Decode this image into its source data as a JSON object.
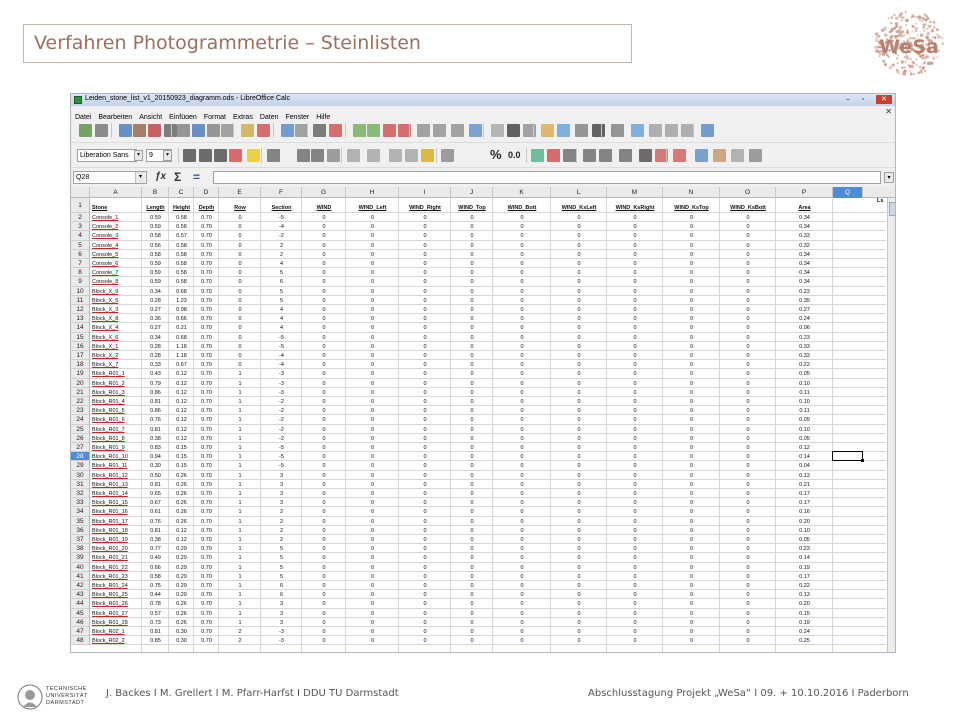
{
  "slide": {
    "title": "Verfahren Photogrammetrie – Steinlisten",
    "logo_text": "WeSa",
    "footer_university": [
      "TECHNISCHE",
      "UNIVERSITÄT",
      "DARMSTADT"
    ],
    "footer_left": "J. Backes I M. Grellert I M. Pfarr-Harfst I DDU TU Darmstadt",
    "footer_right": "Abschlusstagung Projekt „WeSa“ I 09. + 10.10.2016 I Paderborn",
    "colors": {
      "title": "#9c6f5f",
      "title_border": "#cbb5a9",
      "logo": "#b5806c"
    }
  },
  "window": {
    "title": "Leiden_stone_list_v1_20150923_diagramm.ods - LibreOffice Calc",
    "controls": [
      "minimize",
      "maximize",
      "close"
    ]
  },
  "menu": [
    "Datei",
    "Bearbeiten",
    "Ansicht",
    "Einfügen",
    "Format",
    "Extras",
    "Daten",
    "Fenster",
    "Hilfe"
  ],
  "format_toolbar": {
    "font_name": "Liberation Sans",
    "font_size": "9",
    "percent_glyph": "%",
    "number_glyph": "0.0"
  },
  "formula_bar": {
    "cell_ref": "Q28",
    "sum_glyph": "Σ",
    "equals_glyph": "=",
    "value": ""
  },
  "grid": {
    "columns": [
      "A",
      "B",
      "C",
      "D",
      "E",
      "F",
      "G",
      "H",
      "I",
      "J",
      "K",
      "L",
      "M",
      "N",
      "O",
      "P",
      "Q"
    ],
    "active_column": "Q",
    "active_row": 28,
    "header_row": [
      "",
      "Stone",
      "Length",
      "Height",
      "Depth",
      "Row",
      "Section",
      "WIND",
      "WIND_Left",
      "WIND_Right",
      "WIND_Top",
      "WIND_Bott",
      "WIND_KsLeft",
      "WIND_KsRight",
      "WIND_KsTop",
      "WIND_KsBott",
      "Area",
      ""
    ],
    "overflow_header": "Ls",
    "rows": [
      [
        "Console_1",
        "0.59",
        "0.58",
        "0.70",
        "0",
        "-5",
        "0",
        "0",
        "0",
        "0",
        "0",
        "0",
        "0",
        "0",
        "0",
        "0.34"
      ],
      [
        "Console_2",
        "0.59",
        "0.58",
        "0.70",
        "0",
        "-4",
        "0",
        "0",
        "0",
        "0",
        "0",
        "0",
        "0",
        "0",
        "0",
        "0.34"
      ],
      [
        "Console_3",
        "0.58",
        "0.57",
        "0.70",
        "0",
        "-2",
        "0",
        "0",
        "0",
        "0",
        "0",
        "0",
        "0",
        "0",
        "0",
        "0.33"
      ],
      [
        "Console_4",
        "0.56",
        "0.58",
        "0.70",
        "0",
        "2",
        "0",
        "0",
        "0",
        "0",
        "0",
        "0",
        "0",
        "0",
        "0",
        "0.32"
      ],
      [
        "Console_5",
        "0.58",
        "0.58",
        "0.70",
        "0",
        "2",
        "0",
        "0",
        "0",
        "0",
        "0",
        "0",
        "0",
        "0",
        "0",
        "0.34"
      ],
      [
        "Console_6",
        "0.59",
        "0.58",
        "0.70",
        "0",
        "4",
        "0",
        "0",
        "0",
        "0",
        "0",
        "0",
        "0",
        "0",
        "0",
        "0.34"
      ],
      [
        "Console_7",
        "0.59",
        "0.58",
        "0.70",
        "0",
        "5",
        "0",
        "0",
        "0",
        "0",
        "0",
        "0",
        "0",
        "0",
        "0",
        "0.34"
      ],
      [
        "Console_8",
        "0.59",
        "0.58",
        "0.70",
        "0",
        "6",
        "0",
        "0",
        "0",
        "0",
        "0",
        "0",
        "0",
        "0",
        "0",
        "0.34"
      ],
      [
        "Block_X_9",
        "0.34",
        "0.68",
        "0.70",
        "0",
        "5",
        "0",
        "0",
        "0",
        "0",
        "0",
        "0",
        "0",
        "0",
        "0",
        "0.23"
      ],
      [
        "Block_X_5",
        "0.28",
        "1.23",
        "0.70",
        "0",
        "5",
        "0",
        "0",
        "0",
        "0",
        "0",
        "0",
        "0",
        "0",
        "0",
        "0.35"
      ],
      [
        "Block_X_3",
        "0.27",
        "0.98",
        "0.70",
        "0",
        "4",
        "0",
        "0",
        "0",
        "0",
        "0",
        "0",
        "0",
        "0",
        "0",
        "0.27"
      ],
      [
        "Block_X_8",
        "0.36",
        "0.66",
        "0.70",
        "0",
        "4",
        "0",
        "0",
        "0",
        "0",
        "0",
        "0",
        "0",
        "0",
        "0",
        "0.24"
      ],
      [
        "Block_X_4",
        "0.27",
        "0.21",
        "0.70",
        "0",
        "4",
        "0",
        "0",
        "0",
        "0",
        "0",
        "0",
        "0",
        "0",
        "0",
        "0.06"
      ],
      [
        "Block_X_6",
        "0.34",
        "0.68",
        "0.70",
        "0",
        "-5",
        "0",
        "0",
        "0",
        "0",
        "0",
        "0",
        "0",
        "0",
        "0",
        "0.23"
      ],
      [
        "Block_X_1",
        "0.28",
        "1.18",
        "0.70",
        "0",
        "-5",
        "0",
        "0",
        "0",
        "0",
        "0",
        "0",
        "0",
        "0",
        "0",
        "0.33"
      ],
      [
        "Block_X_2",
        "0.28",
        "1.18",
        "0.70",
        "0",
        "-4",
        "0",
        "0",
        "0",
        "0",
        "0",
        "0",
        "0",
        "0",
        "0",
        "0.33"
      ],
      [
        "Block_X_7",
        "0.33",
        "0.67",
        "0.70",
        "0",
        "-4",
        "0",
        "0",
        "0",
        "0",
        "0",
        "0",
        "0",
        "0",
        "0",
        "0.22"
      ],
      [
        "Block_R01_1",
        "0.43",
        "0.12",
        "0.70",
        "1",
        "-3",
        "0",
        "0",
        "0",
        "0",
        "0",
        "0",
        "0",
        "0",
        "0",
        "0.05"
      ],
      [
        "Block_R01_2",
        "0.79",
        "0.12",
        "0.70",
        "1",
        "-3",
        "0",
        "0",
        "0",
        "0",
        "0",
        "0",
        "0",
        "0",
        "0",
        "0.10"
      ],
      [
        "Block_R01_3",
        "0.86",
        "0.12",
        "0.70",
        "1",
        "-3",
        "0",
        "0",
        "0",
        "0",
        "0",
        "0",
        "0",
        "0",
        "0",
        "0.11"
      ],
      [
        "Block_R01_4",
        "0.81",
        "0.12",
        "0.70",
        "1",
        "-2",
        "0",
        "0",
        "0",
        "0",
        "0",
        "0",
        "0",
        "0",
        "0",
        "0.10"
      ],
      [
        "Block_R01_5",
        "0.86",
        "0.12",
        "0.70",
        "1",
        "-2",
        "0",
        "0",
        "0",
        "0",
        "0",
        "0",
        "0",
        "0",
        "0",
        "0.11"
      ],
      [
        "Block_R01_6",
        "0.76",
        "0.12",
        "0.70",
        "1",
        "-2",
        "0",
        "0",
        "0",
        "0",
        "0",
        "0",
        "0",
        "0",
        "0",
        "0.09"
      ],
      [
        "Block_R01_7",
        "0.81",
        "0.12",
        "0.70",
        "1",
        "-2",
        "0",
        "0",
        "0",
        "0",
        "0",
        "0",
        "0",
        "0",
        "0",
        "0.10"
      ],
      [
        "Block_R01_8",
        "0.38",
        "0.12",
        "0.70",
        "1",
        "-2",
        "0",
        "0",
        "0",
        "0",
        "0",
        "0",
        "0",
        "0",
        "0",
        "0.05"
      ],
      [
        "Block_R01_9",
        "0.83",
        "0.15",
        "0.70",
        "1",
        "-5",
        "0",
        "0",
        "0",
        "0",
        "0",
        "0",
        "0",
        "0",
        "0",
        "0.12"
      ],
      [
        "Block_R01_10",
        "0.94",
        "0.15",
        "0.70",
        "1",
        "-5",
        "0",
        "0",
        "0",
        "0",
        "0",
        "0",
        "0",
        "0",
        "0",
        "0.14"
      ],
      [
        "Block_R01_11",
        "0.30",
        "0.15",
        "0.70",
        "1",
        "-5",
        "0",
        "0",
        "0",
        "0",
        "0",
        "0",
        "0",
        "0",
        "0",
        "0.04"
      ],
      [
        "Block_R01_12",
        "0.50",
        "0.26",
        "0.70",
        "1",
        "3",
        "0",
        "0",
        "0",
        "0",
        "0",
        "0",
        "0",
        "0",
        "0",
        "0.13"
      ],
      [
        "Block_R01_13",
        "0.81",
        "0.26",
        "0.70",
        "1",
        "3",
        "0",
        "0",
        "0",
        "0",
        "0",
        "0",
        "0",
        "0",
        "0",
        "0.21"
      ],
      [
        "Block_R01_14",
        "0.65",
        "0.26",
        "0.70",
        "1",
        "3",
        "0",
        "0",
        "0",
        "0",
        "0",
        "0",
        "0",
        "0",
        "0",
        "0.17"
      ],
      [
        "Block_R01_15",
        "0.67",
        "0.26",
        "0.70",
        "1",
        "3",
        "0",
        "0",
        "0",
        "0",
        "0",
        "0",
        "0",
        "0",
        "0",
        "0.17"
      ],
      [
        "Block_R01_16",
        "0.61",
        "0.26",
        "0.70",
        "1",
        "2",
        "0",
        "0",
        "0",
        "0",
        "0",
        "0",
        "0",
        "0",
        "0",
        "0.16"
      ],
      [
        "Block_R01_17",
        "0.76",
        "0.26",
        "0.70",
        "1",
        "2",
        "0",
        "0",
        "0",
        "0",
        "0",
        "0",
        "0",
        "0",
        "0",
        "0.20"
      ],
      [
        "Block_R01_18",
        "0.81",
        "0.12",
        "0.70",
        "1",
        "2",
        "0",
        "0",
        "0",
        "0",
        "0",
        "0",
        "0",
        "0",
        "0",
        "0.10"
      ],
      [
        "Block_R01_19",
        "0.38",
        "0.12",
        "0.70",
        "1",
        "2",
        "0",
        "0",
        "0",
        "0",
        "0",
        "0",
        "0",
        "0",
        "0",
        "0.05"
      ],
      [
        "Block_R01_20",
        "0.77",
        "0.29",
        "0.70",
        "1",
        "5",
        "0",
        "0",
        "0",
        "0",
        "0",
        "0",
        "0",
        "0",
        "0",
        "0.23"
      ],
      [
        "Block_R01_21",
        "0.49",
        "0.29",
        "0.70",
        "1",
        "5",
        "0",
        "0",
        "0",
        "0",
        "0",
        "0",
        "0",
        "0",
        "0",
        "0.14"
      ],
      [
        "Block_R01_22",
        "0.66",
        "0.29",
        "0.70",
        "1",
        "5",
        "0",
        "0",
        "0",
        "0",
        "0",
        "0",
        "0",
        "0",
        "0",
        "0.19"
      ],
      [
        "Block_R01_23",
        "0.58",
        "0.29",
        "0.70",
        "1",
        "5",
        "0",
        "0",
        "0",
        "0",
        "0",
        "0",
        "0",
        "0",
        "0",
        "0.17"
      ],
      [
        "Block_R01_24",
        "0.75",
        "0.29",
        "0.70",
        "1",
        "6",
        "0",
        "0",
        "0",
        "0",
        "0",
        "0",
        "0",
        "0",
        "0",
        "0.22"
      ],
      [
        "Block_R01_25",
        "0.44",
        "0.29",
        "0.70",
        "1",
        "6",
        "0",
        "0",
        "0",
        "0",
        "0",
        "0",
        "0",
        "0",
        "0",
        "0.13"
      ],
      [
        "Block_R01_26",
        "0.78",
        "0.26",
        "0.70",
        "1",
        "3",
        "0",
        "0",
        "0",
        "0",
        "0",
        "0",
        "0",
        "0",
        "0",
        "0.20"
      ],
      [
        "Block_R01_27",
        "0.57",
        "0.26",
        "0.70",
        "1",
        "3",
        "0",
        "0",
        "0",
        "0",
        "0",
        "0",
        "0",
        "0",
        "0",
        "0.15"
      ],
      [
        "Block_R01_28",
        "0.73",
        "0.26",
        "0.70",
        "1",
        "3",
        "0",
        "0",
        "0",
        "0",
        "0",
        "0",
        "0",
        "0",
        "0",
        "0.19"
      ],
      [
        "Block_R02_1",
        "0.81",
        "0.30",
        "0.70",
        "2",
        "-3",
        "0",
        "0",
        "0",
        "0",
        "0",
        "0",
        "0",
        "0",
        "0",
        "0.24"
      ],
      [
        "Block_R02_2",
        "0.85",
        "0.30",
        "0.70",
        "2",
        "-3",
        "0",
        "0",
        "0",
        "0",
        "0",
        "0",
        "0",
        "0",
        "0",
        "0.25"
      ]
    ]
  }
}
